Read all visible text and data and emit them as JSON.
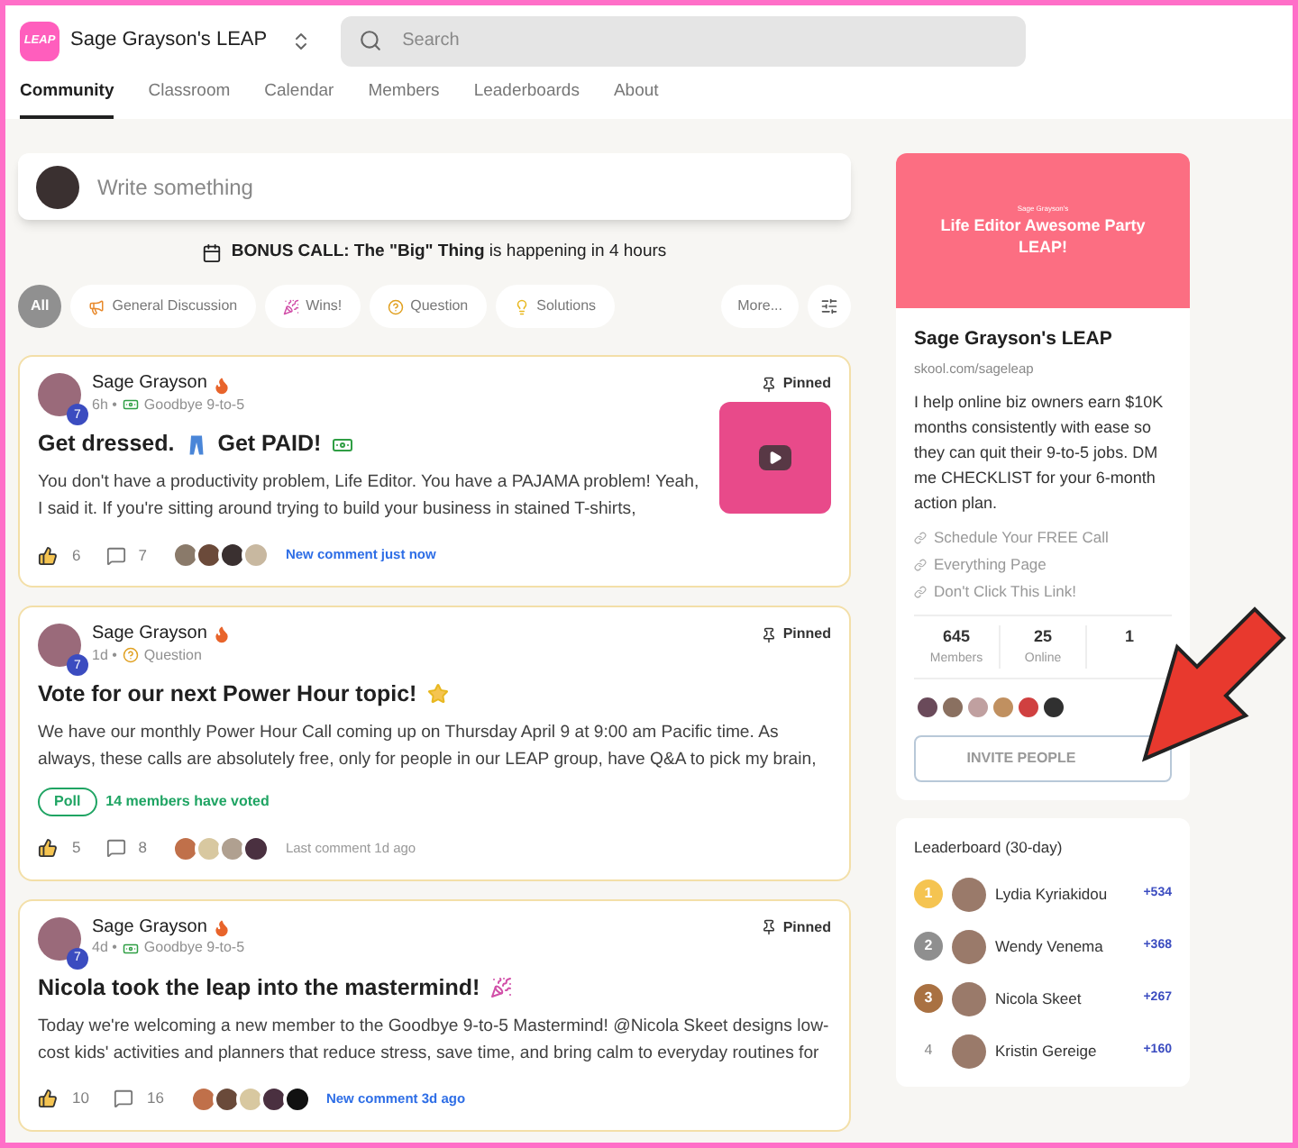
{
  "header": {
    "logo": "LEAP",
    "group_name": "Sage Grayson's LEAP",
    "search": {
      "placeholder": "Search"
    }
  },
  "tabs": [
    {
      "label": "Community",
      "selected": true
    },
    {
      "label": "Classroom",
      "selected": false
    },
    {
      "label": "Calendar",
      "selected": false
    },
    {
      "label": "Members",
      "selected": false
    },
    {
      "label": "Leaderboards",
      "selected": false
    },
    {
      "label": "About",
      "selected": false
    }
  ],
  "composer": {
    "placeholder": "Write something"
  },
  "event_banner": {
    "title": "BONUS CALL: The \"Big\" Thing",
    "suffix": "is happening in 4 hours"
  },
  "filters": [
    {
      "label": "All",
      "selected": true
    },
    {
      "label": "General Discussion",
      "selected": false
    },
    {
      "label": "Wins!",
      "selected": false
    },
    {
      "label": "Question",
      "selected": false
    },
    {
      "label": "Solutions",
      "selected": false
    }
  ],
  "filters_more": "More...",
  "posts": [
    {
      "author": "Sage Grayson",
      "level": "7",
      "time": "6h •",
      "category": "Goodbye 9-to-5",
      "pinned_label": "Pinned",
      "title": [
        "Get dressed.",
        "Get PAID!"
      ],
      "body": "You don't have a productivity problem, Life Editor. You have a PAJAMA problem! Yeah, I said it. If you're sitting around trying to build your business in stained T-shirts,",
      "likes": "6",
      "comments": "7",
      "activity": {
        "text": "New comment just now",
        "kind": "new"
      }
    },
    {
      "author": "Sage Grayson",
      "level": "7",
      "time": "1d •",
      "category": "Question",
      "pinned_label": "Pinned",
      "title": [
        "Vote for our next Power Hour topic!"
      ],
      "body": "We have our monthly Power Hour Call coming up on Thursday April 9 at 9:00 am Pacific time. As always, these calls are absolutely free, only for people in our LEAP group, have Q&A to pick my brain,",
      "poll": {
        "label": "Poll",
        "votes": "14 members have voted"
      },
      "likes": "5",
      "comments": "8",
      "activity": {
        "text": "Last comment 1d ago",
        "kind": "old"
      }
    },
    {
      "author": "Sage Grayson",
      "level": "7",
      "time": "4d •",
      "category": "Goodbye 9-to-5",
      "pinned_label": "Pinned",
      "title": [
        "Nicola took the leap into the mastermind!"
      ],
      "body": "Today we're welcoming a new member to the Goodbye 9-to-5 Mastermind! @Nicola Skeet designs low-cost kids' activities and planners that reduce stress, save time, and bring calm to everyday routines for",
      "likes": "10",
      "comments": "16",
      "activity": {
        "text": "New comment 3d ago",
        "kind": "new"
      }
    }
  ],
  "about": {
    "banner_small": "Sage Grayson's",
    "banner_title": "Life Editor Awesome Party LEAP!",
    "name": "Sage Grayson's LEAP",
    "url": "skool.com/sageleap",
    "description": "I help online biz owners earn $10K months consistently with ease so they can quit their 9-to-5 jobs. DM me CHECKLIST for your 6-month action plan.",
    "links": [
      "Schedule Your FREE Call",
      "Everything Page",
      "Don't Click This Link!"
    ],
    "stats": [
      {
        "value": "645",
        "label": "Members"
      },
      {
        "value": "25",
        "label": "Online"
      },
      {
        "value": "1"
      }
    ],
    "invite_button": "INVITE PEOPLE"
  },
  "leaderboard": {
    "title": "Leaderboard (30-day)",
    "rows": [
      {
        "rank": "1",
        "kind": "medal",
        "color": "#f5c451",
        "name": "Lydia Kyriakidou",
        "points": "+534"
      },
      {
        "rank": "2",
        "kind": "medal",
        "color": "#8f8f8f",
        "name": "Wendy Venema",
        "points": "+368"
      },
      {
        "rank": "3",
        "kind": "medal",
        "color": "#a97142",
        "name": "Nicola Skeet",
        "points": "+267"
      },
      {
        "rank": "4",
        "kind": "plain",
        "name": "Kristin Gereige",
        "points": "+160"
      }
    ]
  }
}
